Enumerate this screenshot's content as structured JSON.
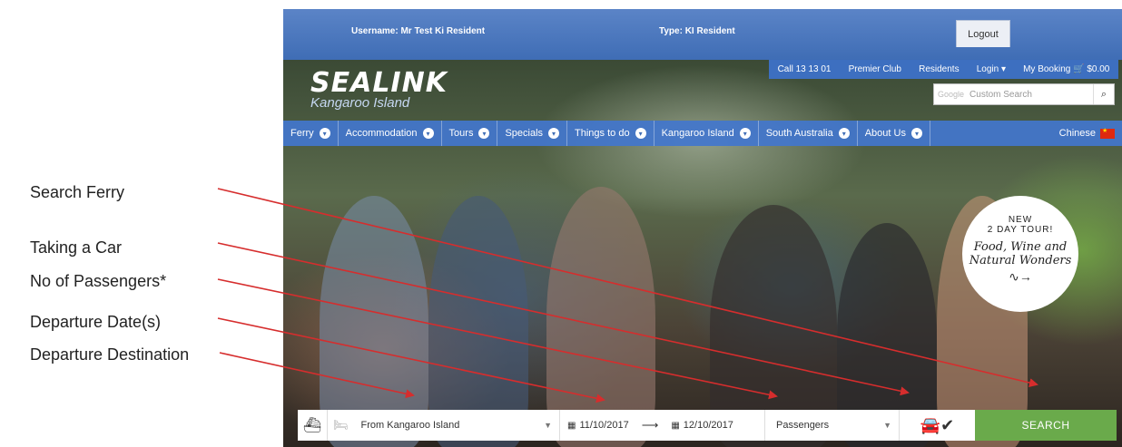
{
  "annotations": {
    "search_ferry": "Search Ferry",
    "taking_car": "Taking a Car",
    "passengers": "No of Passengers*",
    "departure_dates": "Departure Date(s)",
    "departure_destination": "Departure Destination",
    "line_color": "#d62d2d"
  },
  "topbar": {
    "username": "Username: Mr Test Ki Resident",
    "type": "Type: KI Resident",
    "logout": "Logout"
  },
  "logo": {
    "brand": "SEALINK",
    "sub": "Kangaroo Island"
  },
  "utility": {
    "call": "Call 13 13 01",
    "premier": "Premier Club",
    "residents": "Residents",
    "login": "Login ▾",
    "booking": "My Booking 🛒 $0.00"
  },
  "search": {
    "google": "Google",
    "placeholder": "Custom Search"
  },
  "nav": [
    {
      "label": "Ferry"
    },
    {
      "label": "Accommodation"
    },
    {
      "label": "Tours"
    },
    {
      "label": "Specials"
    },
    {
      "label": "Things to do"
    },
    {
      "label": "Kangaroo Island"
    },
    {
      "label": "South Australia"
    },
    {
      "label": "About Us"
    }
  ],
  "lang": "Chinese",
  "promo": {
    "line1": "NEW",
    "line2": "2 DAY TOUR!",
    "line3": "Food, Wine and",
    "line4": "Natural Wonders"
  },
  "booking": {
    "from": "From Kangaroo Island",
    "date_out": "11/10/2017",
    "date_return": "12/10/2017",
    "passengers": "Passengers",
    "search": "SEARCH"
  },
  "colors": {
    "brand_blue": "#3f6db5",
    "search_green": "#6aaa4b"
  }
}
